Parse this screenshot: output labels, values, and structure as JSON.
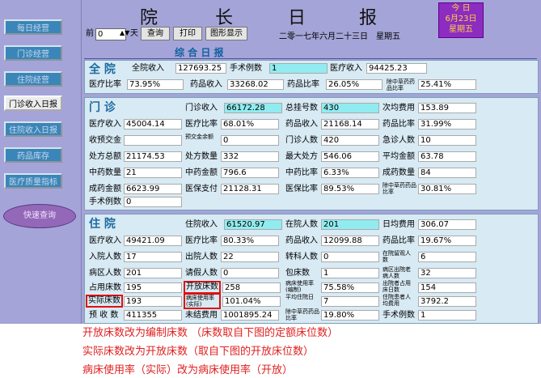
{
  "sidebar": {
    "items": [
      {
        "label": "每日经营"
      },
      {
        "label": "门诊经营"
      },
      {
        "label": "住院经营"
      },
      {
        "label": "门诊收入日报"
      },
      {
        "label": "住院收入日报"
      },
      {
        "label": "药品库存"
      },
      {
        "label": "医疗质量指标"
      }
    ],
    "oval_label": "快速查询"
  },
  "header": {
    "title_chars": [
      "院",
      "长",
      "日",
      "报"
    ],
    "date_box": {
      "line1": "今 日",
      "line2": "6月23日",
      "line3": "星期五"
    },
    "prev_label": "前",
    "days_value": "0",
    "days_unit": "天",
    "query_label": "查询",
    "print_label": "打印",
    "graph_label": "图形显示",
    "date_text": "二零一七年六月二十三日　星期五"
  },
  "summary_title": "综 合 日 报",
  "panels": {
    "total": {
      "title": "全 院",
      "fields": [
        {
          "label": "全院收入",
          "value": "127693.25"
        },
        {
          "label": "手术例数",
          "value": "1"
        },
        {
          "label": "医疗收入",
          "value": "94425.23"
        },
        {
          "label": "医疗比率",
          "value": "73.95%"
        },
        {
          "label": "药品收入",
          "value": "33268.02"
        },
        {
          "label": "药品比率",
          "value": "26.05%"
        },
        {
          "label": "除中草药药品比率",
          "value": "25.41%"
        }
      ]
    },
    "outpatient": {
      "title": "门 诊",
      "fields": [
        {
          "label": "门诊收入",
          "value": "66172.28"
        },
        {
          "label": "总挂号数",
          "value": "430"
        },
        {
          "label": "次均费用",
          "value": "153.89"
        },
        {
          "label": "医疗收入",
          "value": "45004.14"
        },
        {
          "label": "医疗比率",
          "value": "68.01%"
        },
        {
          "label": "药品收入",
          "value": "21168.14"
        },
        {
          "label": "药品比率",
          "value": "31.99%"
        },
        {
          "label": "收预交金",
          "value": ""
        },
        {
          "label": "预交金余额",
          "value": "0"
        },
        {
          "label": "门诊人数",
          "value": "420"
        },
        {
          "label": "急诊人数",
          "value": "10"
        },
        {
          "label": "处方总额",
          "value": "21174.53"
        },
        {
          "label": "处方数量",
          "value": "332"
        },
        {
          "label": "最大处方",
          "value": "546.06"
        },
        {
          "label": "平均金额",
          "value": "63.78"
        },
        {
          "label": "中药数量",
          "value": "21"
        },
        {
          "label": "中药金额",
          "value": "796.6"
        },
        {
          "label": "中药比率",
          "value": "6.33%"
        },
        {
          "label": "成药数量",
          "value": "84"
        },
        {
          "label": "成药金额",
          "value": "6623.99"
        },
        {
          "label": "医保支付",
          "value": "21128.31"
        },
        {
          "label": "医保比率",
          "value": "89.53%"
        },
        {
          "label": "除中草药药品比率",
          "value": "30.81%"
        },
        {
          "label": "手术例数",
          "value": "0"
        }
      ]
    },
    "inpatient": {
      "title": "住 院",
      "fields": [
        {
          "label": "住院收入",
          "value": "61520.97"
        },
        {
          "label": "在院人数",
          "value": "201"
        },
        {
          "label": "日均费用",
          "value": "306.07"
        },
        {
          "label": "医疗收入",
          "value": "49421.09"
        },
        {
          "label": "医疗比率",
          "value": "80.33%"
        },
        {
          "label": "药品收入",
          "value": "12099.88"
        },
        {
          "label": "药品比率",
          "value": "19.67%"
        },
        {
          "label": "入院人数",
          "value": "17"
        },
        {
          "label": "出院人数",
          "value": "22"
        },
        {
          "label": "转科人数",
          "value": "0"
        },
        {
          "label": "在院留观人数",
          "value": "6"
        },
        {
          "label": "病区人数",
          "value": "201"
        },
        {
          "label": "请假人数",
          "value": "0"
        },
        {
          "label": "包床数",
          "value": "1"
        },
        {
          "label": "病区出院老病人数",
          "value": "32"
        },
        {
          "label": "占用床数",
          "value": "195"
        },
        {
          "label": "开放床数",
          "value": "258"
        },
        {
          "label": "病床使用率(编制)",
          "value": "75.58%"
        },
        {
          "label": "出院者占用床日数",
          "value": "154"
        },
        {
          "label": "实际床数",
          "value": "193"
        },
        {
          "label": "病床使用率(实际)",
          "value": "101.04%"
        },
        {
          "label": "平均住院日",
          "value": "7"
        },
        {
          "label": "住院患者人均费用",
          "value": "3792.2"
        },
        {
          "label": "预 收 数",
          "value": "411355"
        },
        {
          "label": "未结费用",
          "value": "1001895.24"
        },
        {
          "label": "除中草药药品比率",
          "value": "19.80%"
        },
        {
          "label": "手术例数",
          "value": "1"
        }
      ]
    }
  },
  "notes": [
    "开放床数改为编制床数 （床数取自下图的定额床位数）",
    "实际床数改为开放床数（取自下图的开放床位数）",
    "病床使用率（实际）改为病床使用率（开放）"
  ]
}
